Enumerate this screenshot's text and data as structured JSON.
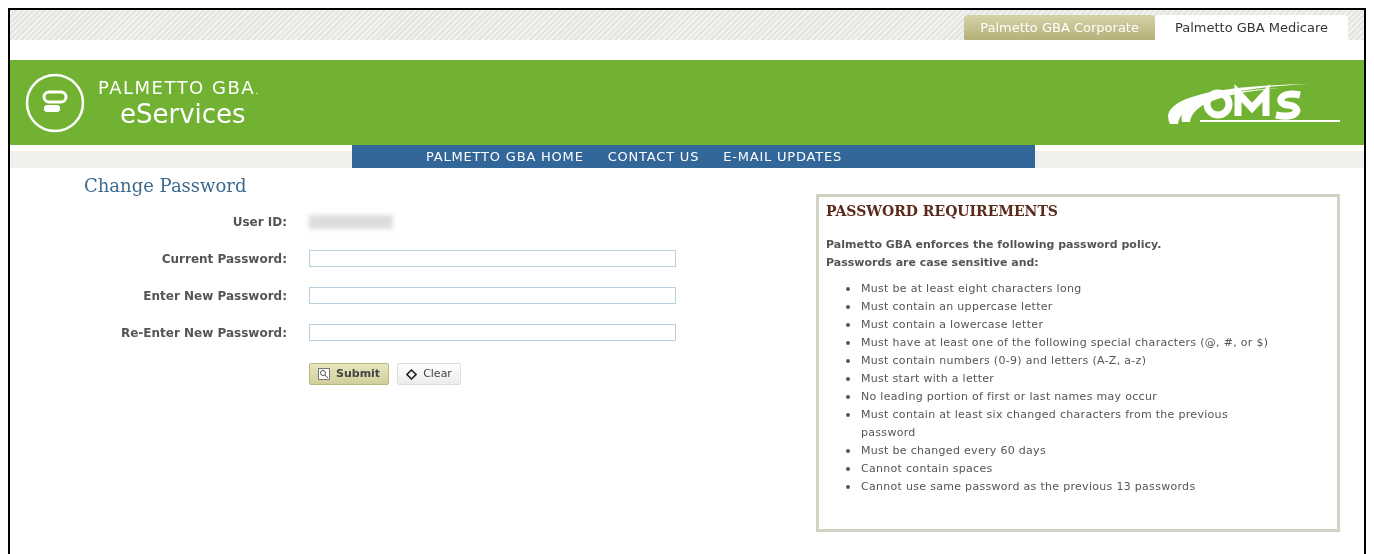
{
  "site_tabs": [
    {
      "label": "Palmetto GBA Corporate",
      "selected": false
    },
    {
      "label": "Palmetto GBA Medicare",
      "selected": true
    }
  ],
  "header": {
    "brand": "PALMETTO GBA",
    "brand_mark": ".",
    "product": "eServices"
  },
  "nav": [
    "PALMETTO GBA HOME",
    "CONTACT US",
    "E-MAIL UPDATES"
  ],
  "page_title": "Change Password",
  "form": {
    "fields": [
      {
        "label": "User ID:",
        "kind": "readonly"
      },
      {
        "label": "Current Password:",
        "kind": "input"
      },
      {
        "label": "Enter New Password:",
        "kind": "input"
      },
      {
        "label": "Re-Enter New Password:",
        "kind": "input"
      }
    ],
    "buttons": [
      {
        "label": "Submit",
        "kind": "primary"
      },
      {
        "label": "Clear",
        "kind": "secondary"
      }
    ]
  },
  "requirements": {
    "title": "PASSWORD REQUIREMENTS",
    "intro": [
      "Palmetto GBA enforces the following password policy.",
      "Passwords are case sensitive and:"
    ],
    "items": [
      "Must be at least eight characters long",
      "Must contain an uppercase letter",
      "Must contain a lowercase letter",
      "Must have at least one of the following special characters (@, #, or $)",
      "Must contain numbers (0-9) and letters (A-Z, a-z)",
      "Must start with a letter",
      "No leading portion of first or last names may occur",
      "Must contain at least six changed characters from the previous password",
      "Must be changed every 60 days",
      "Cannot contain spaces",
      "Cannot use same password as the previous 13 passwords"
    ]
  }
}
